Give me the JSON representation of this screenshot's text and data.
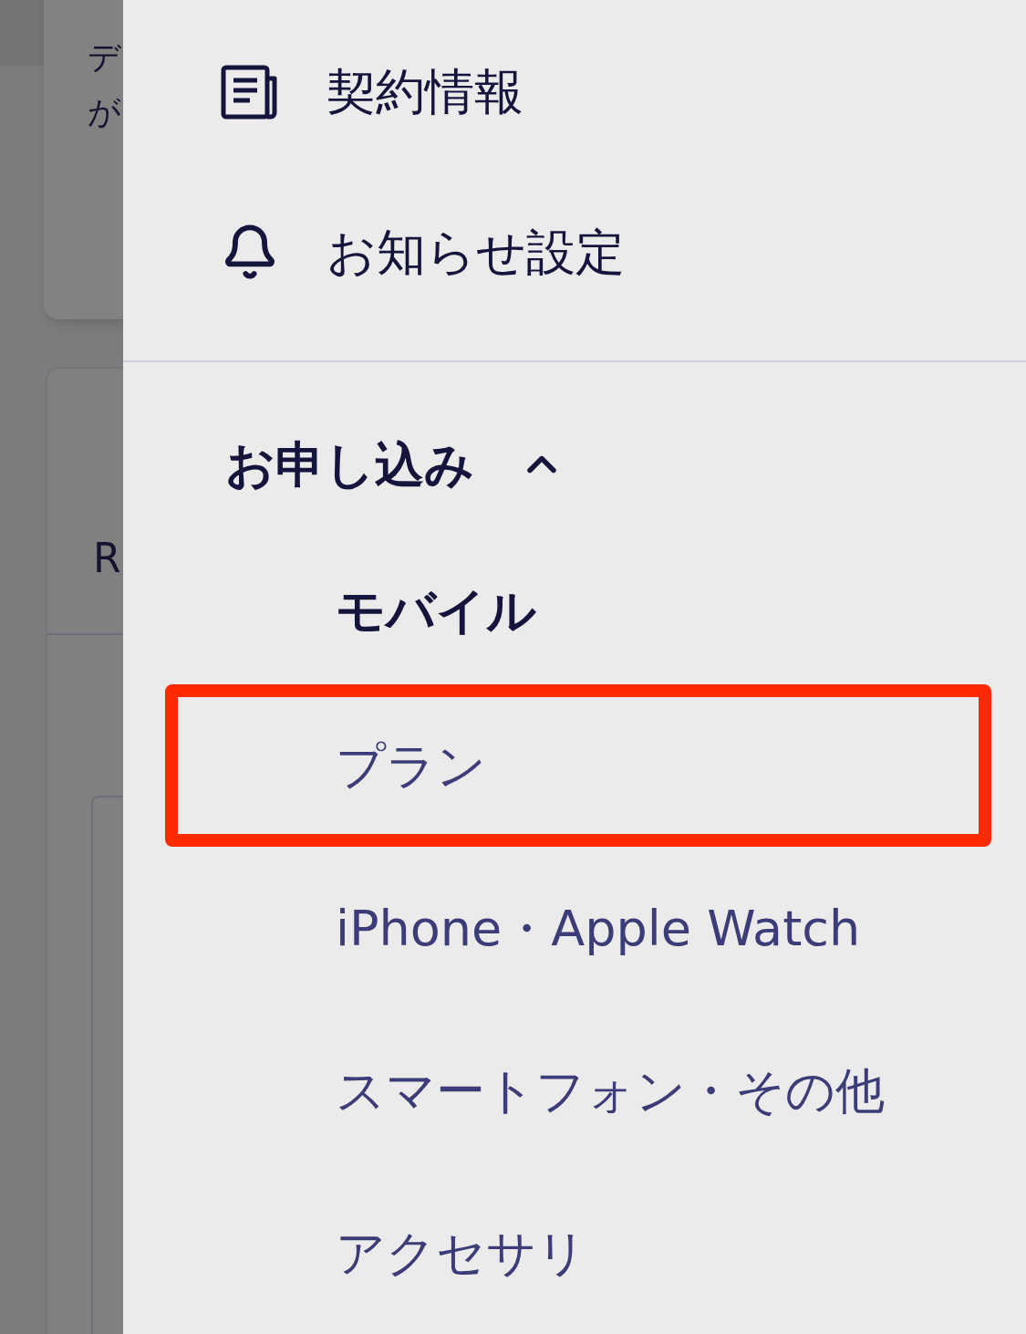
{
  "background": {
    "texts": [
      "デ",
      "が",
      "R"
    ]
  },
  "menu": {
    "items": [
      {
        "kind": "document",
        "label": "契約情報"
      },
      {
        "kind": "bell",
        "label": "お知らせ設定"
      }
    ],
    "section": {
      "title": "お申し込み",
      "expanded": true,
      "group": "モバイル",
      "links": [
        {
          "label": "プラン",
          "highlighted": true
        },
        {
          "label": "iPhone・Apple Watch",
          "highlighted": false
        },
        {
          "label": "スマートフォン・その他",
          "highlighted": false
        },
        {
          "label": "アクセサリ",
          "highlighted": false
        }
      ]
    }
  }
}
